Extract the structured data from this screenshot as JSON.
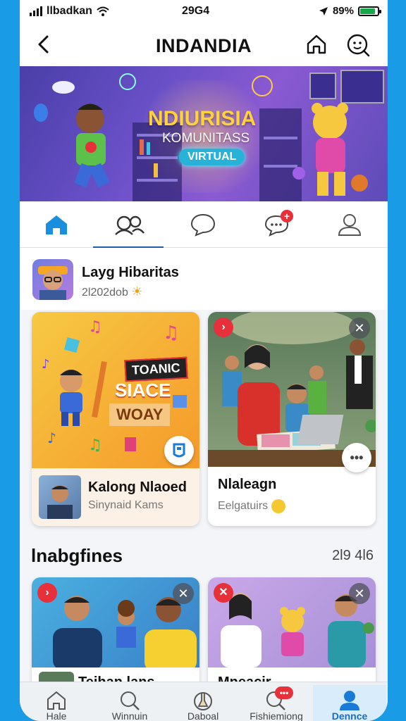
{
  "status_bar": {
    "carrier": "llbadkan",
    "time": "29G4",
    "battery_text": "89%"
  },
  "header": {
    "title": "INDANDIA"
  },
  "banner": {
    "title": "NDIURISIA",
    "subtitle": "KOMUNITASS",
    "pill": "VIRTUAL"
  },
  "profile": {
    "name": "Layg Hibaritas",
    "meta": "2l202dob"
  },
  "cards_row1": [
    {
      "poster_line1": "TOANIC",
      "poster_line2": "SIACE",
      "poster_line3": "WOAY",
      "title": "Kalong Nlaoed",
      "subtitle": "Sinynaid Kams"
    },
    {
      "title": "Nlaleagn",
      "subtitle": "Eelgatuirs"
    }
  ],
  "section": {
    "title": "lnabgfines",
    "count": "2l9 4l6"
  },
  "cards_row2": [
    {
      "title": "Teihan lans"
    },
    {
      "title": "Mneacir"
    }
  ],
  "bottom_nav": [
    {
      "label": "Hale",
      "icon": "home-icon"
    },
    {
      "label": "Winnuin",
      "icon": "search-icon"
    },
    {
      "label": "Daboal",
      "icon": "flask-icon"
    },
    {
      "label": "Fishiemiong",
      "icon": "search-badge-icon"
    },
    {
      "label": "Dennce",
      "icon": "profile-icon"
    }
  ],
  "colors": {
    "accent": "#1a8fe0",
    "active_underline": "#1f5fa8",
    "badge_red": "#e8303a",
    "banner_title": "#ffd23a"
  }
}
